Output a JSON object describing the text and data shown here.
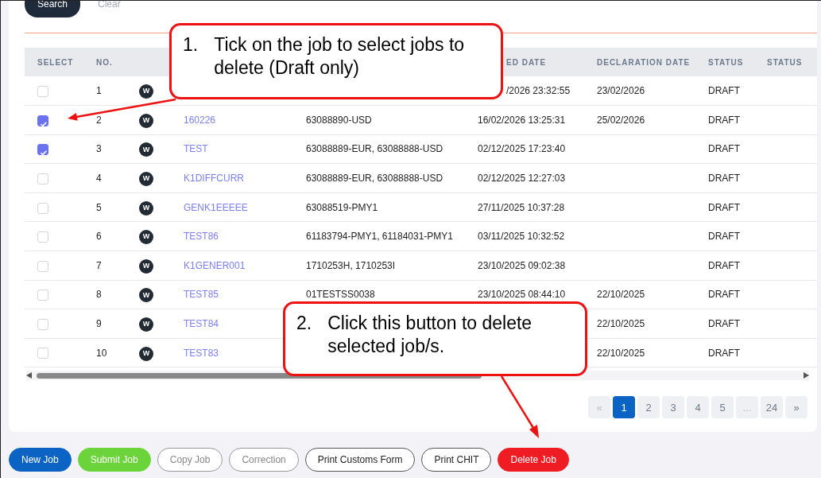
{
  "search_bar": {
    "search_button": "Search",
    "clear_link": "Clear"
  },
  "table": {
    "columns": [
      "SELECT",
      "NO.",
      "",
      "",
      "",
      "ED DATE",
      "DECLARATION DATE",
      "STATUS",
      "STATUS"
    ],
    "rows": [
      {
        "checked": false,
        "no": "1",
        "badge": "W",
        "job_ref": "",
        "invoice": "",
        "created": "/2026 23:32:55",
        "declaration": "23/02/2026",
        "status": "DRAFT"
      },
      {
        "checked": true,
        "no": "2",
        "badge": "W",
        "job_ref": "160226",
        "invoice": "63088890-USD",
        "created": "16/02/2026 13:25:31",
        "declaration": "25/02/2026",
        "status": "DRAFT"
      },
      {
        "checked": true,
        "no": "3",
        "badge": "W",
        "job_ref": "TEST",
        "invoice": "63088889-EUR, 63088888-USD",
        "created": "02/12/2025 17:23:40",
        "declaration": "",
        "status": "DRAFT"
      },
      {
        "checked": false,
        "no": "4",
        "badge": "W",
        "job_ref": "K1DIFFCURR",
        "invoice": "63088889-EUR, 63088888-USD",
        "created": "02/12/2025 12:27:03",
        "declaration": "",
        "status": "DRAFT"
      },
      {
        "checked": false,
        "no": "5",
        "badge": "W",
        "job_ref": "GENK1EEEEE",
        "invoice": "63088519-PMY1",
        "created": "27/11/2025 10:37:28",
        "declaration": "",
        "status": "DRAFT"
      },
      {
        "checked": false,
        "no": "6",
        "badge": "W",
        "job_ref": "TEST86",
        "invoice": "61183794-PMY1, 61184031-PMY1",
        "created": "03/11/2025 10:32:52",
        "declaration": "",
        "status": "DRAFT"
      },
      {
        "checked": false,
        "no": "7",
        "badge": "W",
        "job_ref": "K1GENER001",
        "invoice": "1710253H, 1710253I",
        "created": "23/10/2025 09:02:38",
        "declaration": "",
        "status": "DRAFT"
      },
      {
        "checked": false,
        "no": "8",
        "badge": "W",
        "job_ref": "TEST85",
        "invoice": "01TESTSS0038",
        "created": "23/10/2025 08:44:10",
        "declaration": "22/10/2025",
        "status": "DRAFT"
      },
      {
        "checked": false,
        "no": "9",
        "badge": "W",
        "job_ref": "TEST84",
        "invoice": "",
        "created": "",
        "declaration": "22/10/2025",
        "status": "DRAFT"
      },
      {
        "checked": false,
        "no": "10",
        "badge": "W",
        "job_ref": "TEST83",
        "invoice": "",
        "created": "",
        "declaration": "22/10/2025",
        "status": "DRAFT"
      }
    ]
  },
  "pagination": [
    {
      "label": "«",
      "selected": false,
      "disabled": true
    },
    {
      "label": "1",
      "selected": true,
      "disabled": false
    },
    {
      "label": "2",
      "selected": false,
      "disabled": false
    },
    {
      "label": "3",
      "selected": false,
      "disabled": false
    },
    {
      "label": "4",
      "selected": false,
      "disabled": false
    },
    {
      "label": "5",
      "selected": false,
      "disabled": false
    },
    {
      "label": "...",
      "selected": false,
      "disabled": true
    },
    {
      "label": "24",
      "selected": false,
      "disabled": false
    },
    {
      "label": "»",
      "selected": false,
      "disabled": false
    }
  ],
  "actions": [
    {
      "label": "New Job",
      "kind": "primary",
      "disabled": false
    },
    {
      "label": "Submit Job",
      "kind": "success",
      "disabled": false
    },
    {
      "label": "Copy Job",
      "kind": "outline",
      "disabled": true
    },
    {
      "label": "Correction",
      "kind": "outline",
      "disabled": true
    },
    {
      "label": "Print Customs Form",
      "kind": "outline",
      "disabled": false
    },
    {
      "label": "Print CHIT",
      "kind": "outline",
      "disabled": false
    },
    {
      "label": "Delete Job",
      "kind": "danger",
      "disabled": false
    }
  ],
  "callouts": [
    {
      "number": "1.",
      "text": "Tick on the job to select jobs to delete (Draft only)"
    },
    {
      "number": "2.",
      "text": "Click this button to delete selected job/s."
    }
  ]
}
